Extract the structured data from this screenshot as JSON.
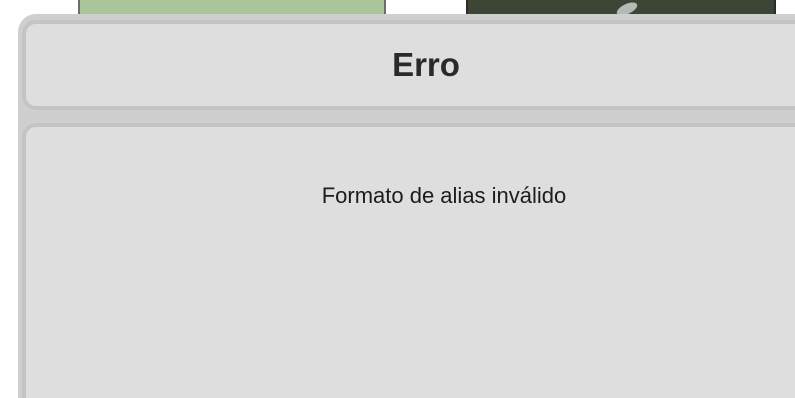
{
  "dialog": {
    "title": "Erro",
    "message": "Formato de alias inválido"
  },
  "colors": {
    "dialog_frame": "#cfcfcf",
    "panel_fill": "#dedede",
    "panel_border": "#c4c4c4",
    "background_left_panel": "#a9c79a",
    "background_right_panel": "#3d4536"
  }
}
